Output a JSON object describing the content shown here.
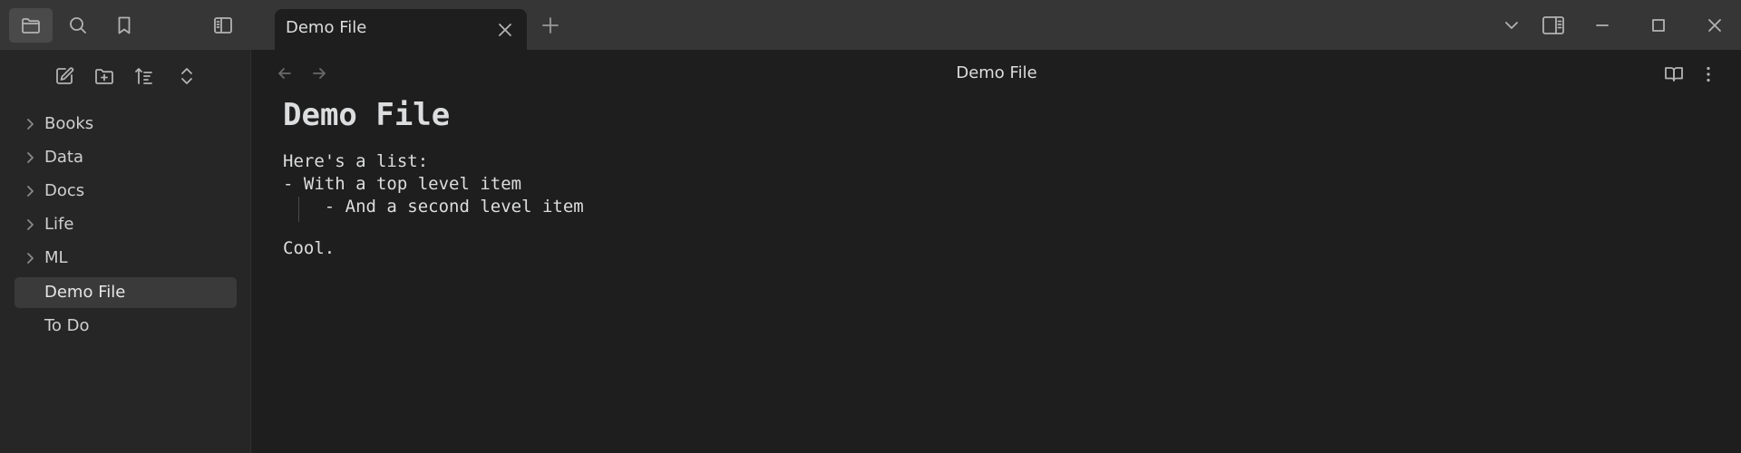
{
  "ribbon": {
    "items": [
      {
        "name": "files-icon",
        "active": true
      },
      {
        "name": "search-icon",
        "active": false
      },
      {
        "name": "bookmark-icon",
        "active": false
      },
      {
        "name": "sidebar-toggle-icon",
        "active": false
      }
    ]
  },
  "tabs": [
    {
      "label": "Demo File",
      "active": true
    }
  ],
  "explorer": {
    "toolbar": [
      "new-note-icon",
      "new-folder-icon",
      "sort-icon",
      "collapse-all-icon"
    ],
    "items": [
      {
        "label": "Books",
        "type": "folder"
      },
      {
        "label": "Data",
        "type": "folder"
      },
      {
        "label": "Docs",
        "type": "folder"
      },
      {
        "label": "Life",
        "type": "folder"
      },
      {
        "label": "ML",
        "type": "folder"
      },
      {
        "label": "Demo File",
        "type": "file",
        "active": true
      },
      {
        "label": "To Do",
        "type": "file"
      }
    ]
  },
  "view": {
    "title": "Demo File"
  },
  "document": {
    "heading": "Demo File",
    "lines": [
      "Here's a list:",
      "- With a top level item",
      "    - And a second level item",
      "Cool."
    ]
  },
  "colors": {
    "background": "#1e1e1e",
    "titlebar": "#363636",
    "sidebar": "#262626",
    "active_item": "#3a3a3a"
  }
}
